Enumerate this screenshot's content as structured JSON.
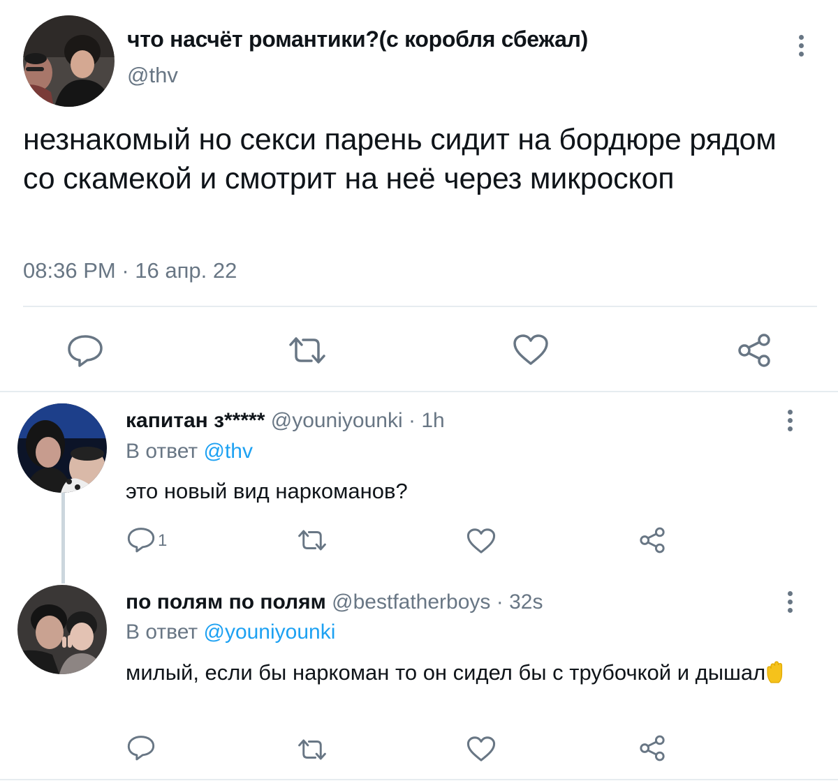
{
  "main_tweet": {
    "display_name": "что насчёт романтики?(с коробля сбежал)",
    "handle": "@thv",
    "text": "незнакомый но секси парень сидит на бордюре рядом со скамекой и смотрит на неё через микроскоп",
    "time": "08:36 PM",
    "date": "16 апр. 22",
    "actions": [
      "reply-icon",
      "retweet-icon",
      "like-icon",
      "share-icon"
    ]
  },
  "replies": [
    {
      "display_name": "капитан з*****",
      "handle": "@youniyounki",
      "age": "1h",
      "reply_prefix": "В ответ",
      "reply_to": "@thv",
      "text": "это новый вид наркоманов?",
      "reply_count": "1"
    },
    {
      "display_name": "по полям по полям",
      "handle": "@bestfatherboys",
      "age": "32s",
      "reply_prefix": "В ответ",
      "reply_to": "@youniyounki",
      "text": "милый, если бы наркоман то он сидел бы с трубочкой и дышал",
      "emoji": "raised-hand-emoji",
      "reply_count": ""
    }
  ],
  "separator": " · ",
  "colors": {
    "text": "#0f1419",
    "secondary": "#687684",
    "link": "#1da1f2",
    "divider": "#e6ecf0"
  }
}
